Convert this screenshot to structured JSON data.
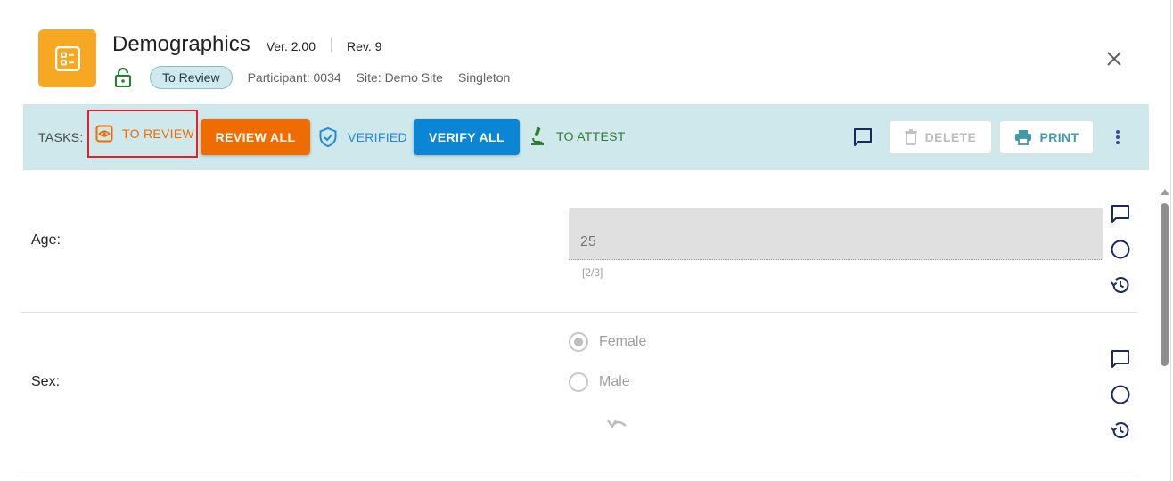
{
  "header": {
    "title": "Demographics",
    "version": "Ver. 2.00",
    "revision": "Rev. 9",
    "status": "To Review",
    "participant": "Participant: 0034",
    "site": "Site: Demo Site",
    "arm": "Singleton"
  },
  "taskbar": {
    "label": "TASKS:",
    "to_review": "TO REVIEW",
    "review_all": "REVIEW ALL",
    "verified": "VERIFIED",
    "verify_all": "VERIFY ALL",
    "to_attest": "TO ATTEST",
    "delete": "DELETE",
    "print": "PRINT"
  },
  "form": {
    "age": {
      "label": "Age:",
      "value": "25",
      "hint": "[2/3]"
    },
    "sex": {
      "label": "Sex:",
      "options": [
        "Female",
        "Male"
      ],
      "selected": "Female"
    }
  },
  "colors": {
    "app_icon": "#f7a823",
    "taskbar_bg": "#cfe8ec",
    "review_orange": "#ef6c00",
    "verify_blue": "#0a86d4",
    "attest_green": "#2e7d32",
    "highlight_red": "#e0202a"
  },
  "icons": {
    "app": "form-list-icon",
    "lock": "lock-open-icon",
    "close": "close-icon",
    "review": "eye-icon",
    "verified": "shield-check-icon",
    "attest": "microscope-icon",
    "comment": "comment-icon",
    "delete": "trash-icon",
    "print": "printer-icon",
    "more": "more-vert-icon",
    "status": "circle-outline-icon",
    "history": "history-icon",
    "undo": "undo-icon"
  }
}
